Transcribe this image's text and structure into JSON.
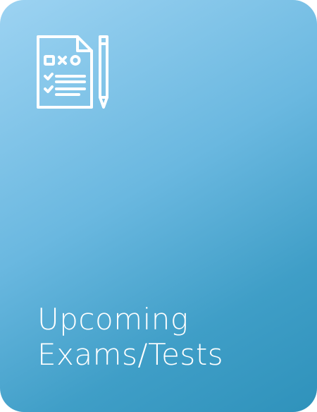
{
  "card": {
    "title_line_1": "Upcoming",
    "title_line_2": "Exams/Tests",
    "icon": "exam-paper-pencil-icon",
    "gradient_start": "#9dd3f2",
    "gradient_end": "#2f92bb",
    "text_color": "#ffffff"
  }
}
